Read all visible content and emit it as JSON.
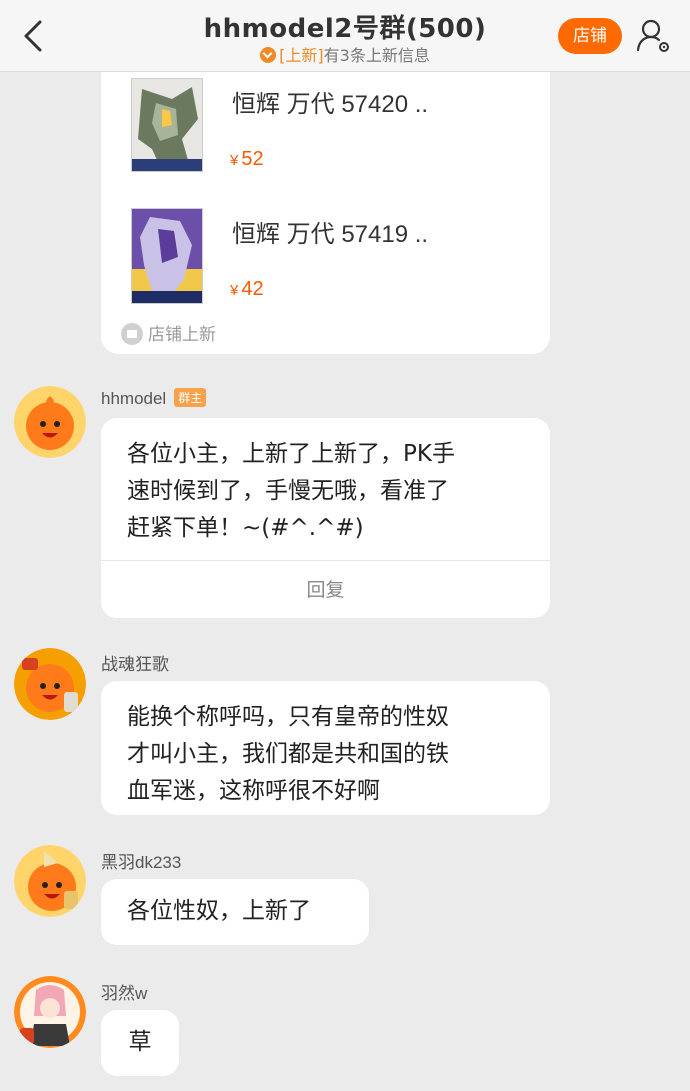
{
  "header": {
    "title": "hhmodel2号群(500)",
    "subtitle_tag": "[上新]",
    "subtitle_text": "有3条上新信息",
    "shop_button": "店铺"
  },
  "shop_card": {
    "products": [
      {
        "name": "恒辉 万代 57420 ..",
        "currency": "¥",
        "price": "52"
      },
      {
        "name": "恒辉 万代 57419 ..",
        "currency": "¥",
        "price": "42"
      }
    ],
    "label": "店铺上新"
  },
  "messages": [
    {
      "sender": "hhmodel",
      "badge": "群主",
      "lines": [
        "各位小主，上新了上新了，PK手",
        "速时候到了，手慢无哦，看准了",
        "赶紧下单！~(#^.^#)"
      ],
      "reply": "回复"
    },
    {
      "sender": "战魂狂歌",
      "lines": [
        "能换个称呼吗，只有皇帝的性奴",
        "才叫小主，我们都是共和国的铁",
        "血军迷，这称呼很不好啊"
      ]
    },
    {
      "sender": "黑羽dk233",
      "lines": [
        "各位性奴，上新了"
      ]
    },
    {
      "sender": "羽然w",
      "lines": [
        "草"
      ]
    }
  ],
  "colors": {
    "accent": "#ff6a00",
    "price": "#ff5a00",
    "background": "#ebebeb"
  }
}
